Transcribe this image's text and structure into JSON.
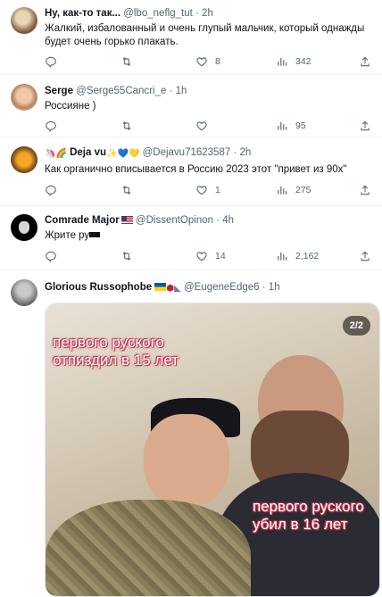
{
  "tweets": [
    {
      "display_name": "Ну, как-то так...",
      "handle": "@lbo_neflg_tut",
      "time": "2h",
      "text": "Жалкий, избалованный и очень глупый мальчик, который однажды будет очень горько плакать.",
      "likes": "8",
      "views": "342"
    },
    {
      "display_name": "Serge",
      "handle": "@Serge55Cancri_e",
      "time": "1h",
      "text": "Россияне )",
      "views": "95"
    },
    {
      "display_name": "Deja vu",
      "handle": "@Dejavu71623587",
      "time": "2h",
      "text": "Как органично вписывается в Россию 2023 этот \"привет из 90х\"",
      "likes": "1",
      "views": "275"
    },
    {
      "display_name": "Comrade Major",
      "handle": "@DissentOpinon",
      "time": "4h",
      "text": "Жрите ру",
      "likes": "14",
      "views": "2,162"
    },
    {
      "display_name": "Glorious Russophobe",
      "handle": "@EugeneEdge6",
      "time": "1h",
      "media": {
        "caption_top": "первого руского отпиздил в 15 лет",
        "caption_bottom": "первого руского убил в 16 лет",
        "counter": "2/2"
      }
    }
  ],
  "icons": [
    "reply-icon",
    "retweet-icon",
    "like-icon",
    "views-icon",
    "share-icon"
  ],
  "colors": {
    "secondary_text": "#536471",
    "divider": "#eff3f4",
    "caption_outline": "#c03a52"
  }
}
